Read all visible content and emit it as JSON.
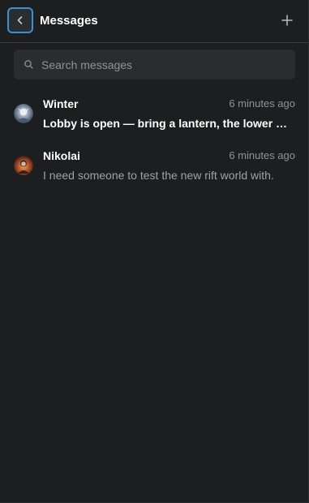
{
  "header": {
    "title": "Messages",
    "back_icon": "chevron-left-icon",
    "add_icon": "plus-icon",
    "accent_color": "#3b8fd6"
  },
  "search": {
    "placeholder": "Search messages",
    "value": "",
    "icon": "search-icon"
  },
  "conversations": [
    {
      "name": "Winter",
      "time": "6 minutes ago",
      "preview": "Lobby is open — bring a lantern, the lower …",
      "unread": true
    },
    {
      "name": "Nikolai",
      "time": "6 minutes ago",
      "preview": "I need someone to test the new rift world with.",
      "unread": false
    }
  ]
}
